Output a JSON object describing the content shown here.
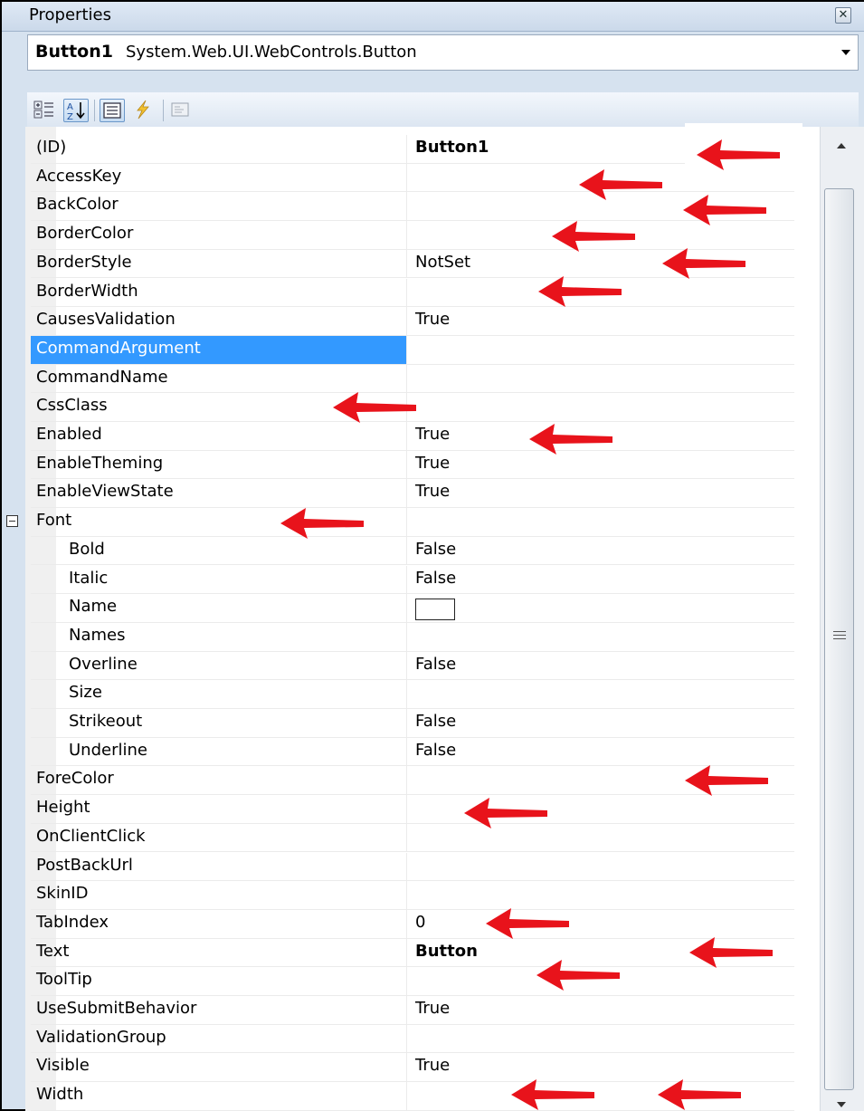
{
  "window": {
    "title": "Properties",
    "close_icon": "close-icon"
  },
  "object_selector": {
    "name": "Button1",
    "type": "System.Web.UI.WebControls.Button"
  },
  "toolbar": {
    "buttons": [
      {
        "name": "categorized-icon",
        "selected": false
      },
      {
        "name": "alphabetical-sort-icon",
        "selected": true
      },
      {
        "name": "properties-icon",
        "selected": true
      },
      {
        "name": "events-lightning-icon",
        "selected": false
      },
      {
        "name": "property-pages-icon",
        "selected": false
      }
    ]
  },
  "properties": [
    {
      "name": "(ID)",
      "value": "Button1",
      "bold": true
    },
    {
      "name": "AccessKey",
      "value": ""
    },
    {
      "name": "BackColor",
      "value": ""
    },
    {
      "name": "BorderColor",
      "value": ""
    },
    {
      "name": "BorderStyle",
      "value": "NotSet"
    },
    {
      "name": "BorderWidth",
      "value": ""
    },
    {
      "name": "CausesValidation",
      "value": "True"
    },
    {
      "name": "CommandArgument",
      "value": "",
      "selected": true
    },
    {
      "name": "CommandName",
      "value": ""
    },
    {
      "name": "CssClass",
      "value": ""
    },
    {
      "name": "Enabled",
      "value": "True"
    },
    {
      "name": "EnableTheming",
      "value": "True"
    },
    {
      "name": "EnableViewState",
      "value": "True"
    },
    {
      "name": "Font",
      "value": "",
      "expander": true
    },
    {
      "name": "Bold",
      "value": "False",
      "child": true
    },
    {
      "name": "Italic",
      "value": "False",
      "child": true
    },
    {
      "name": "Name",
      "value": "",
      "child": true,
      "swatch": true
    },
    {
      "name": "Names",
      "value": "",
      "child": true
    },
    {
      "name": "Overline",
      "value": "False",
      "child": true
    },
    {
      "name": "Size",
      "value": "",
      "child": true
    },
    {
      "name": "Strikeout",
      "value": "False",
      "child": true
    },
    {
      "name": "Underline",
      "value": "False",
      "child": true
    },
    {
      "name": "ForeColor",
      "value": ""
    },
    {
      "name": "Height",
      "value": ""
    },
    {
      "name": "OnClientClick",
      "value": ""
    },
    {
      "name": "PostBackUrl",
      "value": ""
    },
    {
      "name": "SkinID",
      "value": ""
    },
    {
      "name": "TabIndex",
      "value": "0"
    },
    {
      "name": "Text",
      "value": "Button",
      "bold": true
    },
    {
      "name": "ToolTip",
      "value": ""
    },
    {
      "name": "UseSubmitBehavior",
      "value": "True"
    },
    {
      "name": "ValidationGroup",
      "value": ""
    },
    {
      "name": "Visible",
      "value": "True"
    },
    {
      "name": "Width",
      "value": ""
    }
  ],
  "colors": {
    "selection": "#3399ff",
    "annotation_arrow": "#e8131b"
  }
}
